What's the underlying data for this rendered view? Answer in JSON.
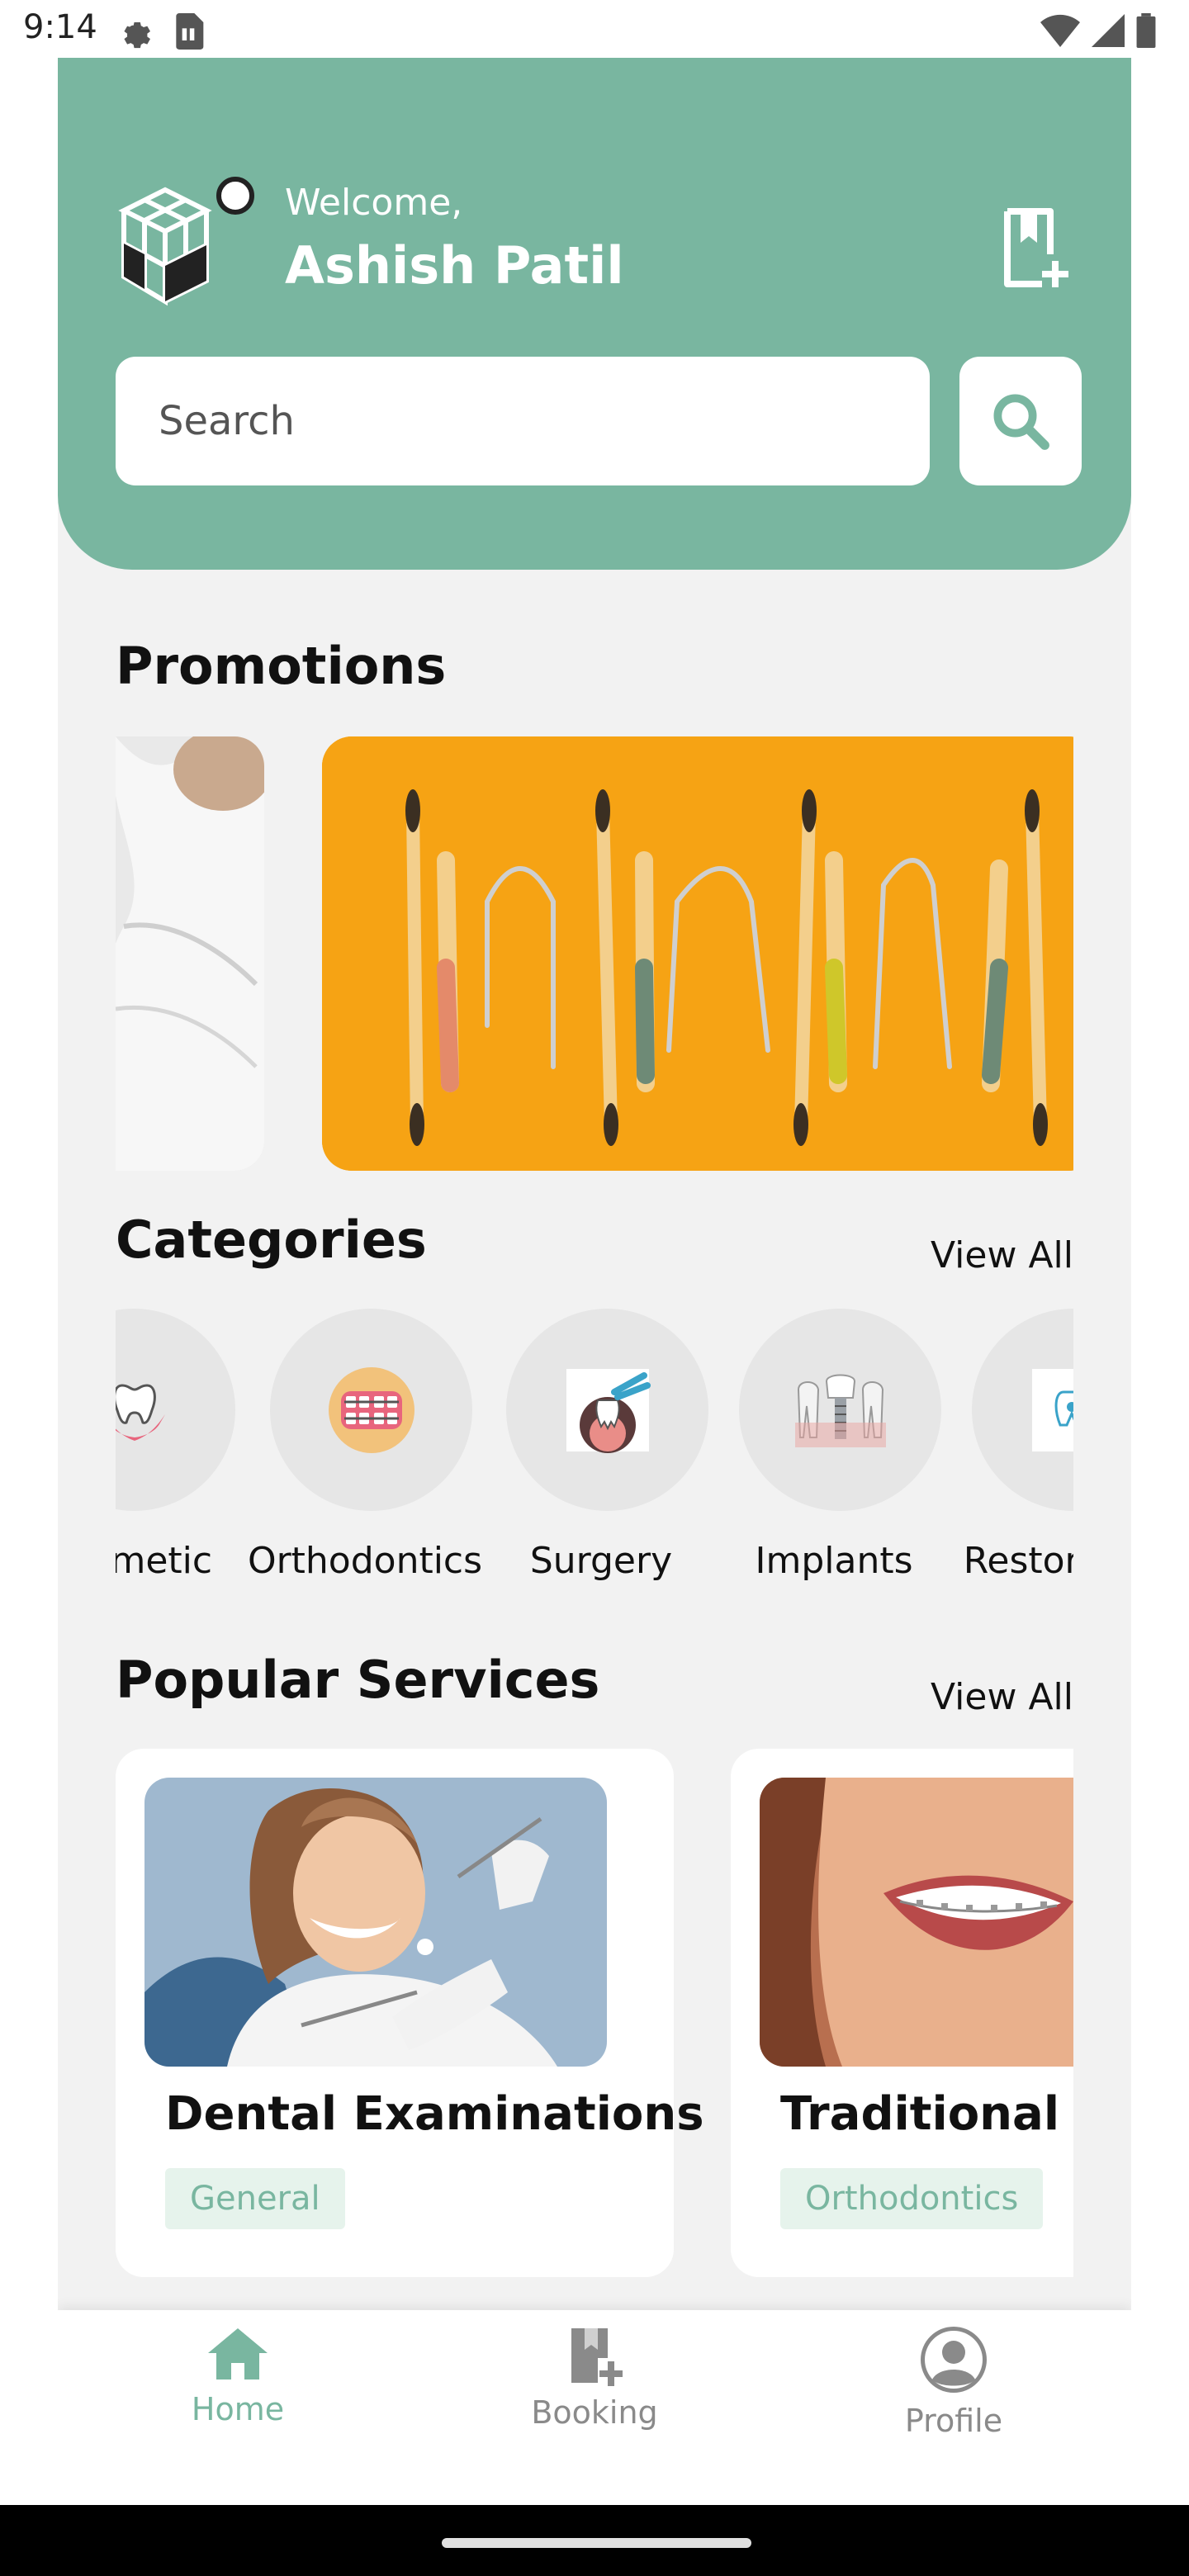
{
  "status_bar": {
    "time": "9:14",
    "icons": [
      "settings-icon",
      "sim-card-icon",
      "wifi-icon",
      "signal-icon",
      "battery-icon"
    ]
  },
  "header": {
    "welcome": "Welcome,",
    "username": "Ashish Patil",
    "search_placeholder": "Search",
    "accent_color": "#79b6a0"
  },
  "promotions": {
    "title": "Promotions"
  },
  "categories": {
    "title": "Categories",
    "view_all": "View All",
    "items": [
      {
        "label": "Cosmetic",
        "icon": "tooth-hands-icon"
      },
      {
        "label": "Orthodontics",
        "icon": "braces-icon"
      },
      {
        "label": "Surgery",
        "icon": "tooth-extraction-icon"
      },
      {
        "label": "Implants",
        "icon": "dental-implant-icon"
      },
      {
        "label": "Restorative",
        "icon": "restorative-tooth-icon"
      }
    ]
  },
  "popular_services": {
    "title": "Popular Services",
    "view_all": "View All",
    "items": [
      {
        "title": "Dental Examinations",
        "tag": "General"
      },
      {
        "title": "Traditional Braces",
        "tag": "Orthodontics"
      }
    ]
  },
  "bottom_nav": {
    "items": [
      {
        "label": "Home",
        "icon": "home-icon",
        "active": true
      },
      {
        "label": "Booking",
        "icon": "booking-icon",
        "active": false
      },
      {
        "label": "Profile",
        "icon": "profile-icon",
        "active": false
      }
    ]
  }
}
